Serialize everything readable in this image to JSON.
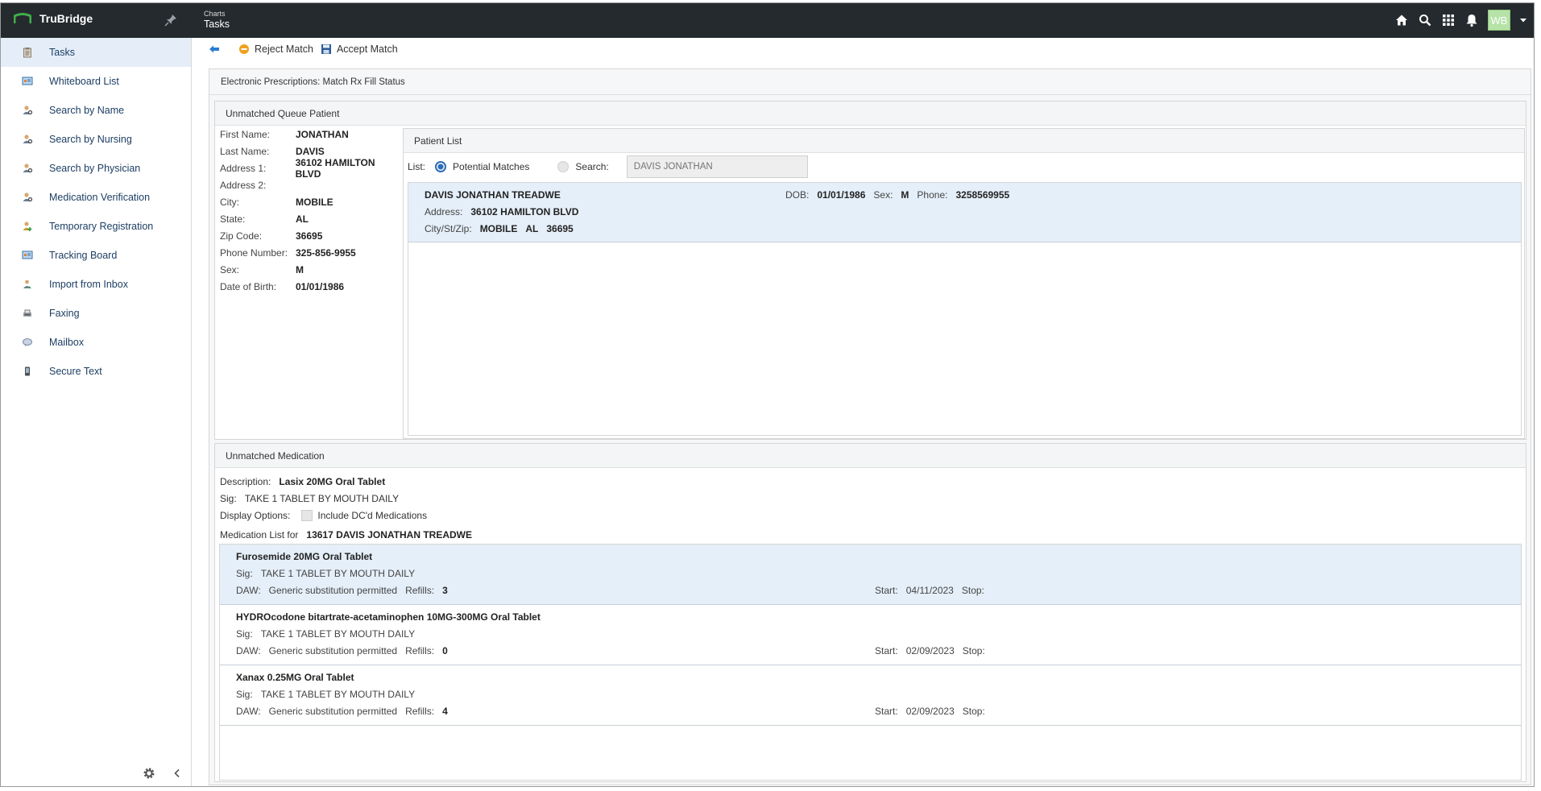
{
  "app": {
    "brand": "TruBridge",
    "breadcrumb_small": "Charts",
    "breadcrumb_title": "Tasks",
    "user_initials": "WB"
  },
  "sidebar": {
    "items": [
      {
        "label": "Tasks",
        "icon": "clipboard-icon",
        "active": true
      },
      {
        "label": "Whiteboard List",
        "icon": "whiteboard-icon"
      },
      {
        "label": "Search by Name",
        "icon": "person-search-icon"
      },
      {
        "label": "Search by Nursing",
        "icon": "person-search-icon"
      },
      {
        "label": "Search by Physician",
        "icon": "person-search-icon"
      },
      {
        "label": "Medication Verification",
        "icon": "person-search-icon"
      },
      {
        "label": "Temporary Registration",
        "icon": "person-add-icon"
      },
      {
        "label": "Tracking Board",
        "icon": "whiteboard-icon"
      },
      {
        "label": "Import from Inbox",
        "icon": "import-icon"
      },
      {
        "label": "Faxing",
        "icon": "fax-icon"
      },
      {
        "label": "Mailbox",
        "icon": "mailbox-icon"
      },
      {
        "label": "Secure Text",
        "icon": "phone-icon"
      }
    ]
  },
  "toolbar": {
    "reject_label": "Reject Match",
    "accept_label": "Accept Match"
  },
  "page": {
    "title": "Electronic Prescriptions: Match Rx Fill Status"
  },
  "patient": {
    "section_title": "Unmatched Queue Patient",
    "fields": [
      {
        "label": "First Name:",
        "value": "JONATHAN"
      },
      {
        "label": "Last Name:",
        "value": "DAVIS"
      },
      {
        "label": "Address 1:",
        "value": "36102 HAMILTON BLVD"
      },
      {
        "label": "Address 2:",
        "value": ""
      },
      {
        "label": "City:",
        "value": "MOBILE"
      },
      {
        "label": "State:",
        "value": "AL"
      },
      {
        "label": "Zip Code:",
        "value": "36695"
      },
      {
        "label": "Phone Number:",
        "value": "325-856-9955"
      },
      {
        "label": "Sex:",
        "value": "M"
      },
      {
        "label": "Date of Birth:",
        "value": "01/01/1986"
      }
    ]
  },
  "patient_list": {
    "title": "Patient List",
    "list_label": "List:",
    "option_potential": "Potential Matches",
    "option_search": "Search:",
    "search_placeholder": "DAVIS JONATHAN",
    "matches": [
      {
        "name": "DAVIS JONATHAN TREADWE",
        "dob_label": "DOB:",
        "dob": "01/01/1986",
        "sex_label": "Sex:",
        "sex": "M",
        "phone_label": "Phone:",
        "phone": "3258569955",
        "address_label": "Address:",
        "address": "36102 HAMILTON BLVD",
        "csz_label": "City/St/Zip:",
        "city": "MOBILE",
        "state": "AL",
        "zip": "36695"
      }
    ]
  },
  "medication": {
    "section_title": "Unmatched Medication",
    "description_label": "Description:",
    "description": "Lasix 20MG Oral Tablet",
    "sig_label": "Sig:",
    "sig": "TAKE 1 TABLET BY MOUTH DAILY",
    "display_label": "Display Options:",
    "include_dc_label": "Include DC'd Medications",
    "list_for_label": "Medication List for",
    "list_for_value": "13617 DAVIS JONATHAN TREADWE",
    "list": [
      {
        "name": "Furosemide 20MG Oral Tablet",
        "sig": "TAKE 1 TABLET BY MOUTH DAILY",
        "daw": "Generic substitution permitted",
        "refills": "3",
        "start": "04/11/2023",
        "stop": ""
      },
      {
        "name": "HYDROcodone bitartrate-acetaminophen 10MG-300MG Oral Tablet",
        "sig": "TAKE 1 TABLET BY MOUTH DAILY",
        "daw": "Generic substitution permitted",
        "refills": "0",
        "start": "02/09/2023",
        "stop": ""
      },
      {
        "name": "Xanax 0.25MG Oral Tablet",
        "sig": "TAKE 1 TABLET BY MOUTH DAILY",
        "daw": "Generic substitution permitted",
        "refills": "4",
        "start": "02/09/2023",
        "stop": ""
      }
    ],
    "labels": {
      "sig": "Sig:",
      "daw": "DAW:",
      "refills": "Refills:",
      "start": "Start:",
      "stop": "Stop:"
    }
  },
  "colors": {
    "topbar": "#252a2e",
    "accent": "#2b6cb7",
    "selected_row": "#e5eff9",
    "avatar": "#b6e2a8",
    "brand_green": "#3fae49"
  }
}
